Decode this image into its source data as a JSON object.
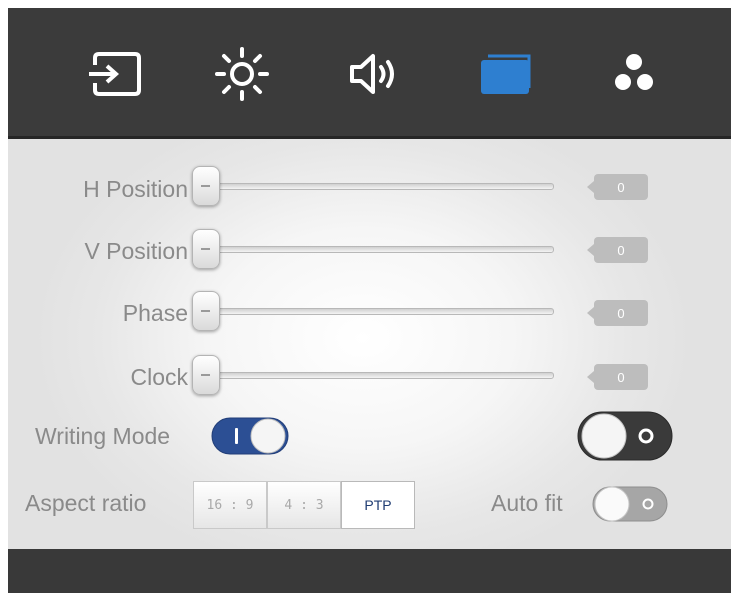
{
  "tabs": [
    {
      "icon": "input-source-icon",
      "active": false
    },
    {
      "icon": "brightness-icon",
      "active": false
    },
    {
      "icon": "volume-icon",
      "active": false
    },
    {
      "icon": "display-window-icon",
      "active": true
    },
    {
      "icon": "dots-cluster-icon",
      "active": false
    }
  ],
  "sliders": [
    {
      "label": "H Position",
      "value": "0"
    },
    {
      "label": "V Position",
      "value": "0"
    },
    {
      "label": "Phase",
      "value": "0"
    },
    {
      "label": "Clock",
      "value": "0"
    }
  ],
  "writing_mode": {
    "label": "Writing Mode",
    "on": true
  },
  "right_toggle": {
    "on": false
  },
  "aspect_ratio": {
    "label": "Aspect ratio",
    "options": [
      "16 : 9",
      "4 : 3",
      "PTP"
    ],
    "selected": "PTP"
  },
  "auto_fit": {
    "label": "Auto fit",
    "on": false
  },
  "colors": {
    "accent": "#2e7fd0",
    "toggle_on": "#2c4f94",
    "top_bar": "#3b3b3b",
    "label_gray": "#8a8a8a"
  }
}
